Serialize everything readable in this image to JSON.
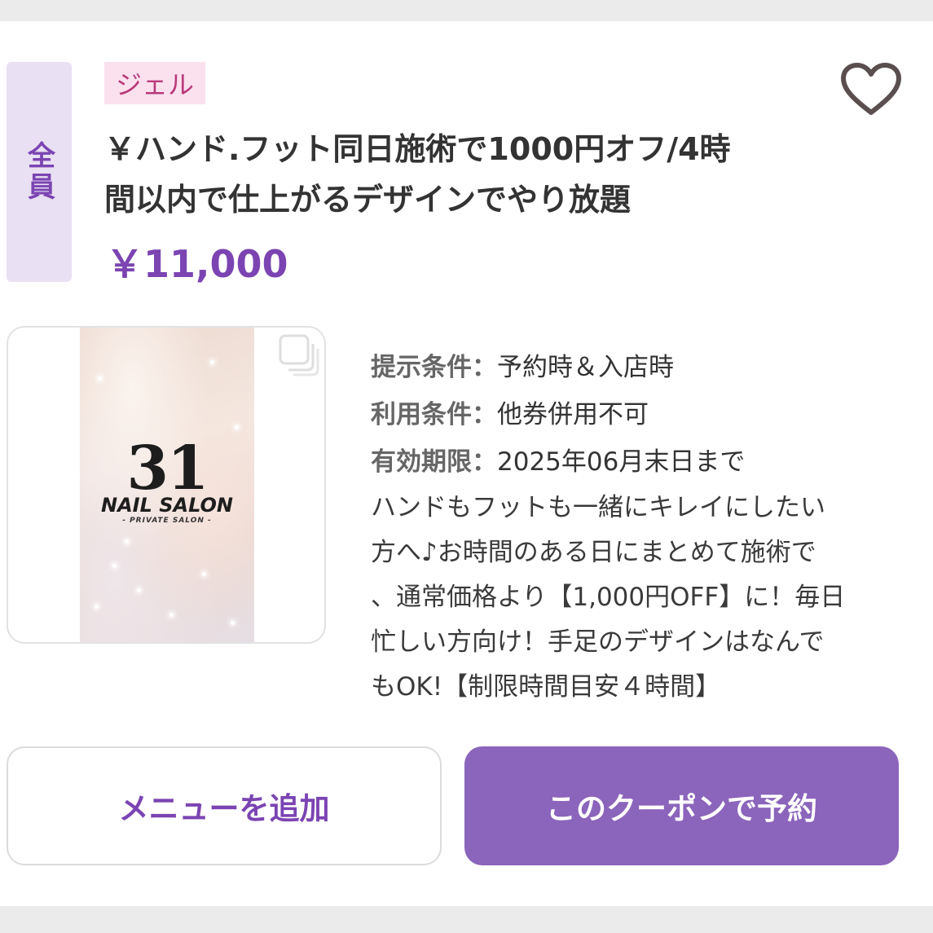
{
  "coupon": {
    "target_label": "全員",
    "category_tag": "ジェル",
    "title_line1": "￥ハンド.フット同日施術で1000円オフ/4時",
    "title_line2": "間以内で仕上がるデザインでやり放題",
    "price": "￥11,000",
    "favorite_icon": "heart-outline-icon",
    "image": {
      "logo_number": "31",
      "logo_name": "NAIL SALON",
      "logo_sub": "- PRIVATE SALON -",
      "gallery_icon": "gallery-stack-icon"
    },
    "conditions": [
      {
        "label": "提示条件：",
        "value": "予約時＆入店時"
      },
      {
        "label": "利用条件：",
        "value": "他券併用不可"
      },
      {
        "label": "有効期限：",
        "value": "2025年06月末日まで"
      }
    ],
    "description": [
      "ハンドもフットも一緒にキレイにしたい",
      "方へ♪お時間のある日にまとめて施術で",
      "、通常価格より【1,000円OFF】に！毎日",
      "忙しい方向け！手足のデザインはなんで",
      "もOK!【制限時間目安４時間】"
    ]
  },
  "buttons": {
    "add_menu": "メニューを追加",
    "reserve": "このクーポンで予約"
  },
  "colors": {
    "accent": "#7b44b2",
    "reserve_button": "#8b64bb",
    "tag_background": "#fbe1ee",
    "tag_text": "#b93a7a",
    "target_badge_background": "#e9e0f3"
  }
}
